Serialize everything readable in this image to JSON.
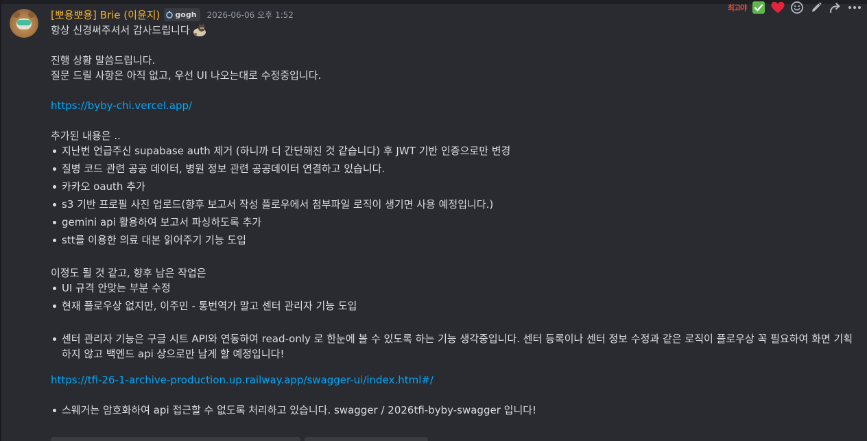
{
  "message": {
    "username": "[뽀용뽀용] Brie (이윤지)",
    "tag": "gogh",
    "timestamp": "2026-06-06 오후 1:52",
    "line1": "항상 신경써주셔서 감사드립니다",
    "line2": "진행 상황 말씀드립니다.",
    "line3": "질문 드릴 사항은 아직 없고, 우선 UI 나오는대로 수정중입니다.",
    "link1": "https://byby-chi.vercel.app/",
    "added_intro": "추가된 내용은 ..",
    "added_items": [
      "지난번 언급주신 supabase auth 제거 (하니까 더 간단해진 것 같습니다) 후 JWT 기반 인증으로만 변경",
      "질병 코드 관련 공공 데이터, 병원 정보 관련 공공데이터 연결하고 있습니다.",
      "카카오 oauth 추가",
      "s3 기반 프로필 사진 업로드(향후 보고서 작성 플로우에서 첨부파일 로직이 생기면 사용 예정입니다.)",
      "gemini api 활용하여 보고서 파싱하도록 추가",
      "stt를 이용한 의료 대본 읽어주기 기능 도입"
    ],
    "remaining_intro": "이정도 될 것 같고, 향후 남은 작업은",
    "remaining_items": [
      "UI 규격 안맞는 부분 수정",
      "현재 플로우상 없지만, 이주민 - 통번역가 말고 센터 관리자 기능 도입"
    ],
    "center_item": "센터 관리자 기능은 구글 시트 API와 연동하여 read-only 로 한눈에 볼 수 있도록 하는 기능 생각중입니다. 센터 등록이나 센터 정보 수정과 같은 로직이 플로우상 꼭 필요하여 화면 기획하지 않고 백엔드 api 상으로만 남게 할 예정입니다!",
    "link2": "https://tfi-26-1-archive-production.up.railway.app/swagger-ui/index.html#/",
    "swagger_item": "스웨거는 암호화하여 api 접근할 수 없도록 처리하고 있습니다. swagger / 2026tfi-byby-swagger 입니다!"
  },
  "actions": {
    "custom_reaction": "최고야",
    "reactions": [
      "check-mark-icon",
      "heart-icon"
    ],
    "tools": [
      "add-reaction-icon",
      "edit-icon",
      "forward-icon",
      "more-icon"
    ]
  },
  "colors": {
    "background": "#2a2b30",
    "text": "#dbdee1",
    "username": "#f0b232",
    "link": "#00a8fc",
    "timestamp": "#949ba4"
  }
}
